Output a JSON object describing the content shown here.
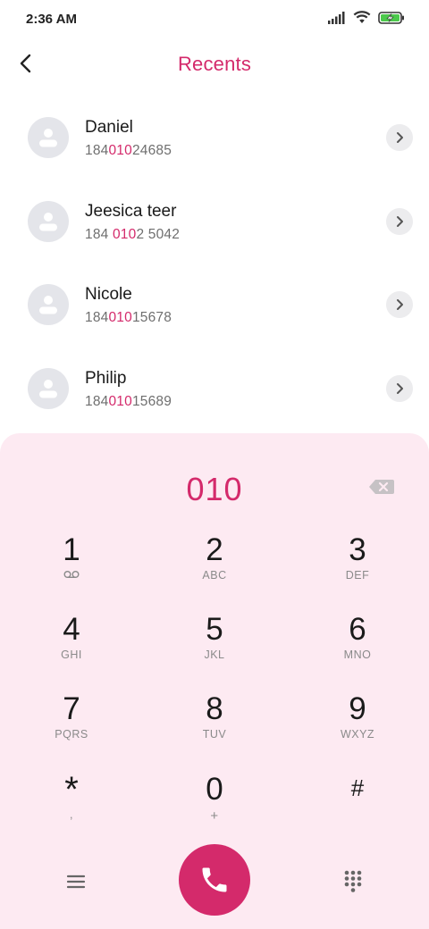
{
  "status_bar": {
    "time": "2:36 AM",
    "icons": [
      "signal-icon",
      "wifi-icon",
      "battery-charging-icon"
    ]
  },
  "header": {
    "title": "Recents",
    "back_icon": "back-arrow-icon"
  },
  "contacts": [
    {
      "name": "Daniel",
      "number_pre": "184",
      "number_match": "010",
      "number_post": "24685"
    },
    {
      "name": "Jeesica teer",
      "number_pre": "184 ",
      "number_match": "010",
      "number_post": "2 5042"
    },
    {
      "name": "Nicole",
      "number_pre": "184",
      "number_match": "010",
      "number_post": "15678"
    },
    {
      "name": "Philip",
      "number_pre": "184",
      "number_match": "010",
      "number_post": "15689"
    }
  ],
  "dialpad": {
    "input": "010",
    "keys": [
      {
        "num": "1",
        "sub": "voicemail-icon"
      },
      {
        "num": "2",
        "sub": "ABC"
      },
      {
        "num": "3",
        "sub": "DEF"
      },
      {
        "num": "4",
        "sub": "GHI"
      },
      {
        "num": "5",
        "sub": "JKL"
      },
      {
        "num": "6",
        "sub": "MNO"
      },
      {
        "num": "7",
        "sub": "PQRS"
      },
      {
        "num": "8",
        "sub": "TUV"
      },
      {
        "num": "9",
        "sub": "WXYZ"
      },
      {
        "num": "*",
        "sub": ","
      },
      {
        "num": "0",
        "sub": "+"
      },
      {
        "num": "#",
        "sub": ""
      }
    ]
  },
  "colors": {
    "accent": "#d42a6b",
    "dialpad_bg": "#fdeaf2",
    "avatar_bg": "#e4e5ea"
  }
}
